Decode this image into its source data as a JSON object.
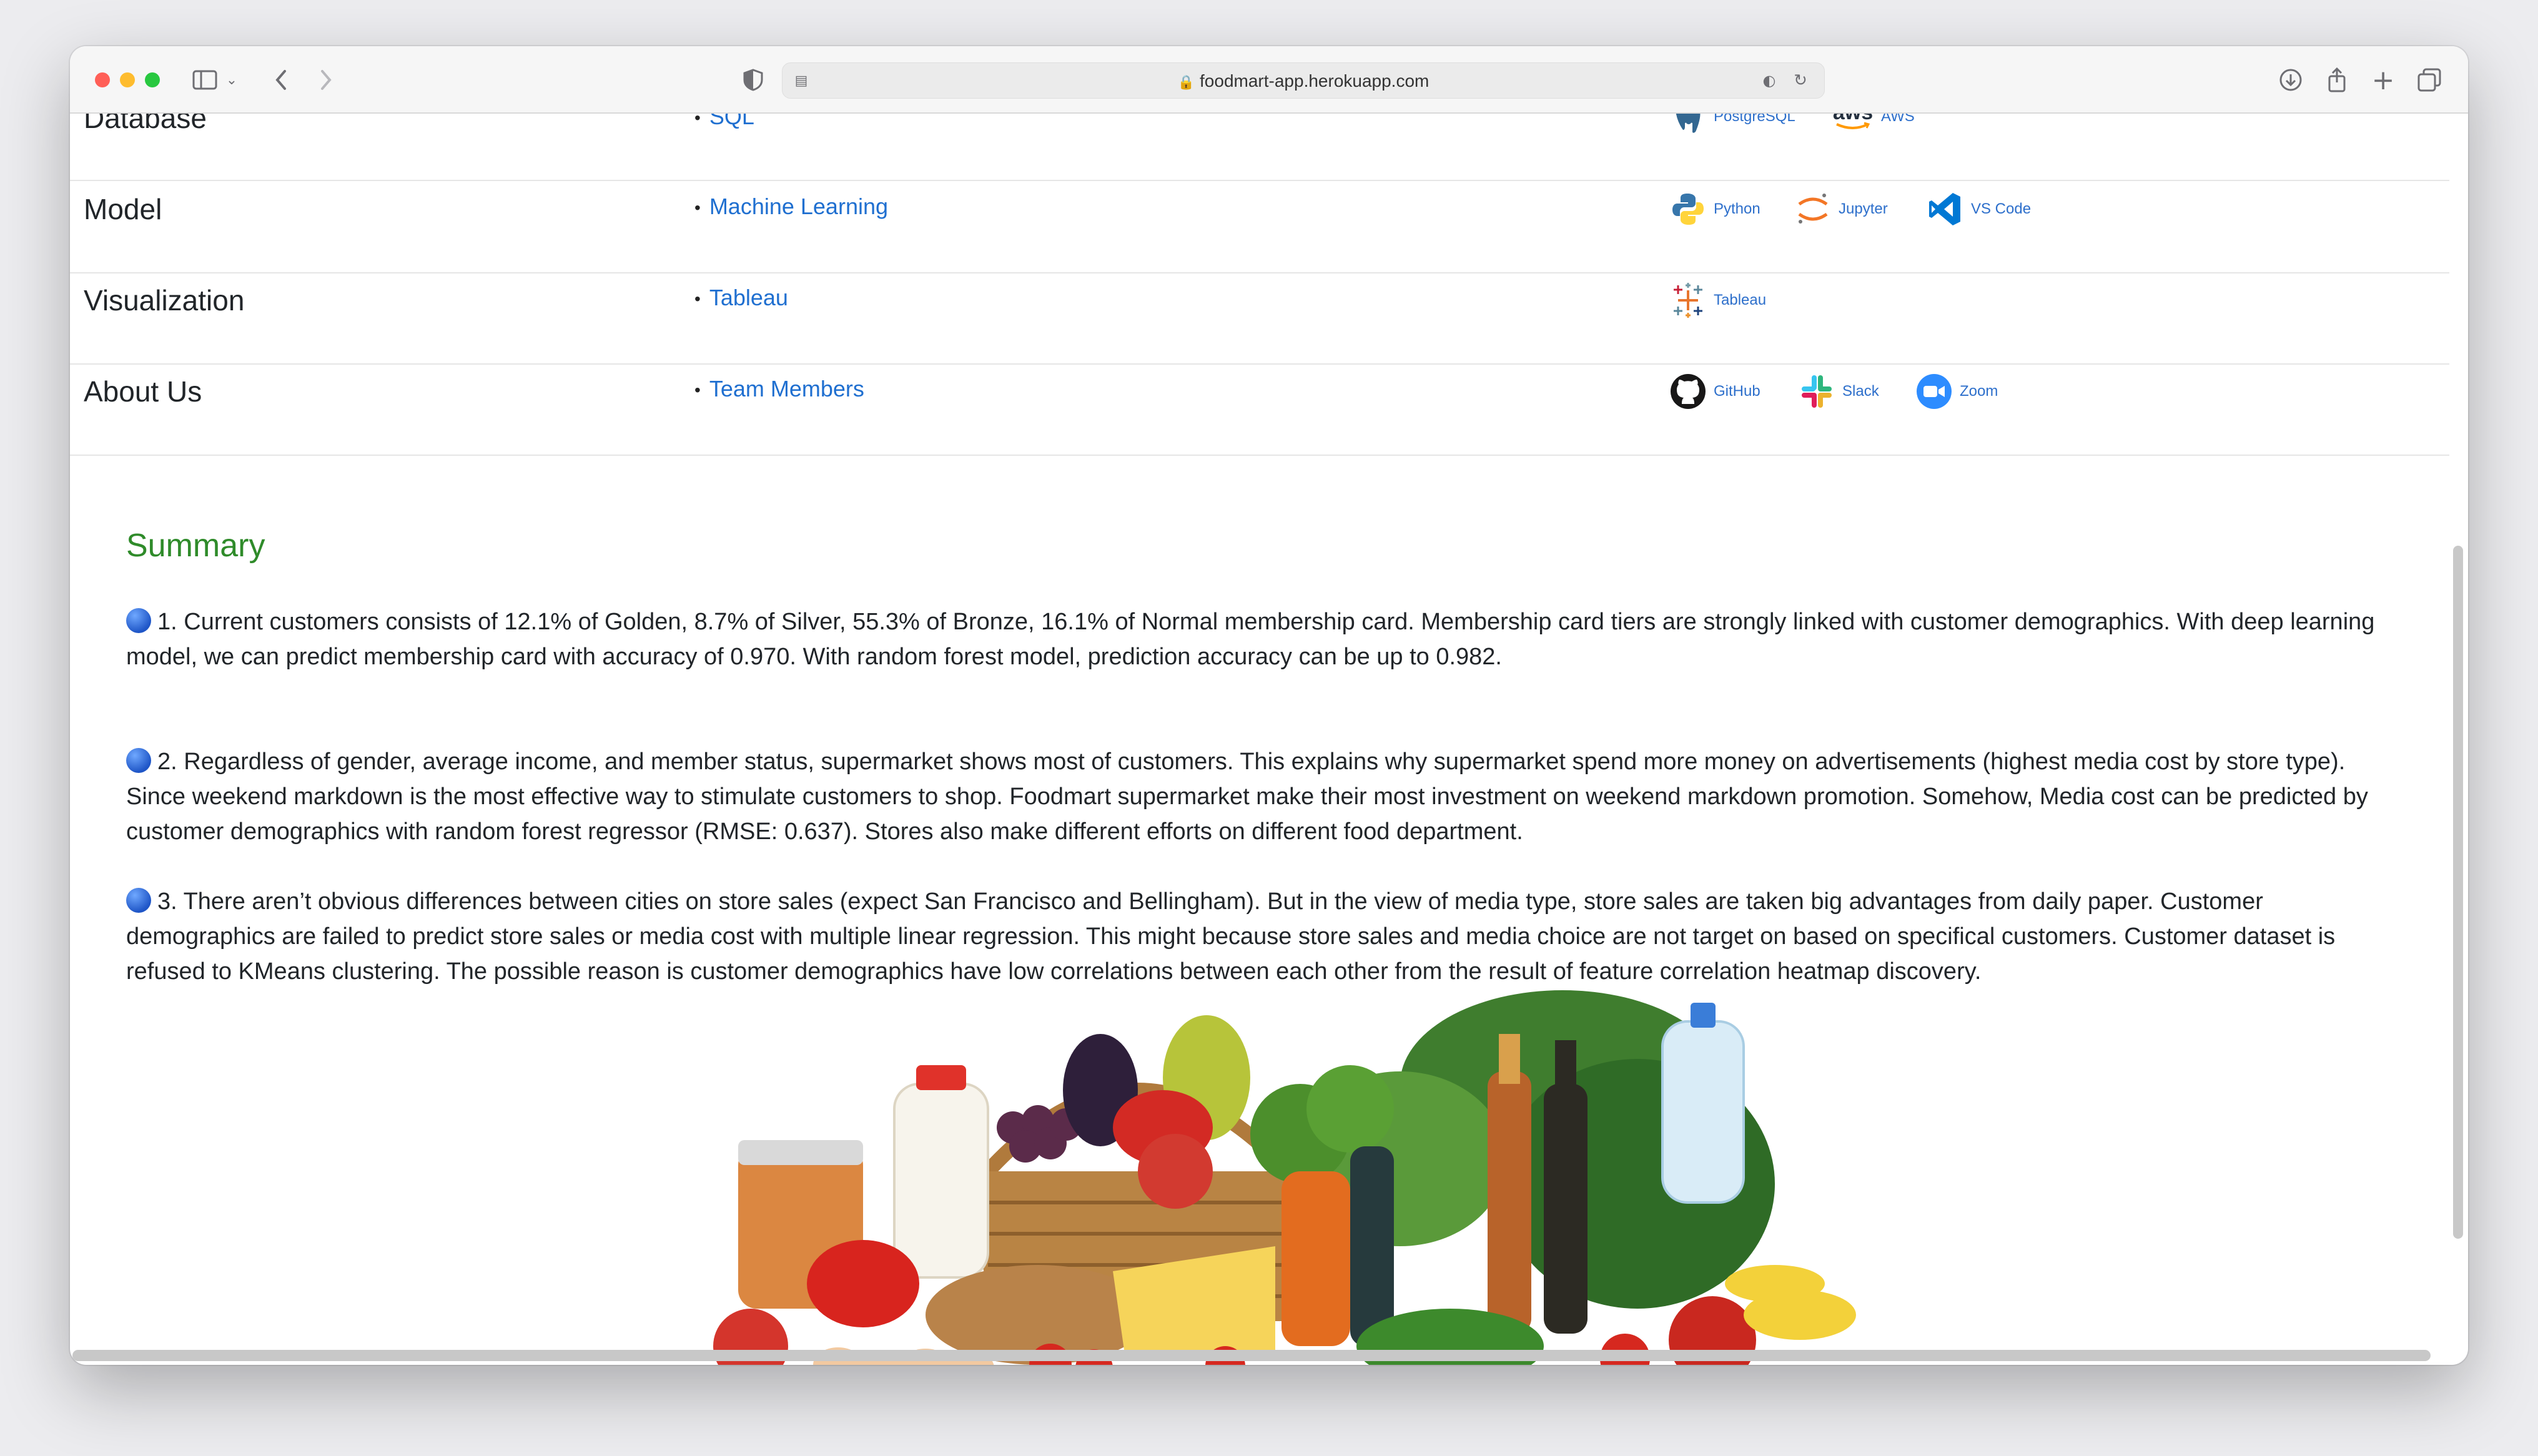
{
  "browser": {
    "url": "foodmart-app.herokuapp.com"
  },
  "tech_stack": [
    {
      "category": "Database",
      "item": "SQL",
      "tools": [
        {
          "name": "PostgreSQL",
          "icon": "postgresql-icon"
        },
        {
          "name": "AWS",
          "icon": "aws-icon"
        }
      ]
    },
    {
      "category": "Model",
      "item": "Machine Learning",
      "tools": [
        {
          "name": "Python",
          "icon": "python-icon"
        },
        {
          "name": "Jupyter",
          "icon": "jupyter-icon"
        },
        {
          "name": "VS Code",
          "icon": "vscode-icon"
        }
      ]
    },
    {
      "category": "Visualization",
      "item": "Tableau",
      "tools": [
        {
          "name": "Tableau",
          "icon": "tableau-icon"
        }
      ]
    },
    {
      "category": "About Us",
      "item": "Team Members",
      "tools": [
        {
          "name": "GitHub",
          "icon": "github-icon"
        },
        {
          "name": "Slack",
          "icon": "slack-icon"
        },
        {
          "name": "Zoom",
          "icon": "zoom-icon"
        }
      ]
    }
  ],
  "aws_wordmark": "aws",
  "summary": {
    "title": "Summary",
    "points": [
      "1. Current customers consists of 12.1% of Golden, 8.7% of Silver, 55.3% of Bronze, 16.1% of Normal membership card. Membership card tiers are strongly linked with customer demographics. With deep learning model, we can predict membership card with accuracy of 0.970. With random forest model, prediction accuracy can be up to 0.982.",
      "2. Regardless of gender, average income, and member status, supermarket shows most of customers. This explains why supermarket spend more money on advertisements (highest media cost by store type). Since weekend markdown is the most effective way to stimulate customers to shop. Foodmart supermarket make their most investment on weekend markdown promotion. Somehow, Media cost can be predicted by customer demographics with random forest regressor (RMSE: 0.637). Stores also make different efforts on different food department.",
      "3. There aren’t obvious differences between cities on store sales (expect San Francisco and Bellingham). But in the view of media type, store sales are taken big advantages from daily paper. Customer demographics are failed to predict store sales or media cost with multiple linear regression. This might because store sales and media choice are not target on based on specifical customers. Customer dataset is refused to KMeans clustering. The possible reason is customer demographics have low correlations between each other from the result of feature correlation heatmap discovery."
    ]
  },
  "colors": {
    "link": "#1f6fd0",
    "summary_title": "#2f8b2a",
    "text": "#212529"
  }
}
